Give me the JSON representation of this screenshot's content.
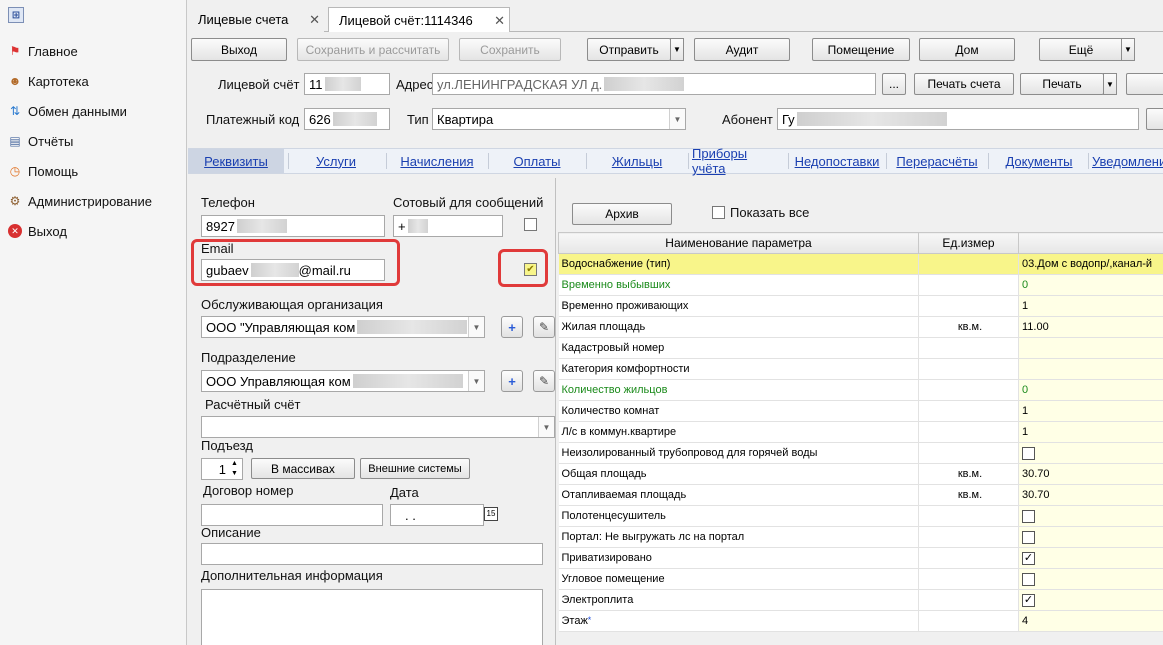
{
  "sidebar": {
    "items": [
      {
        "label": "Главное",
        "icon": "flag-icon"
      },
      {
        "label": "Картотека",
        "icon": "people-icon"
      },
      {
        "label": "Обмен данными",
        "icon": "exchange-icon"
      },
      {
        "label": "Отчёты",
        "icon": "reports-icon"
      },
      {
        "label": "Помощь",
        "icon": "help-icon"
      },
      {
        "label": "Администрирование",
        "icon": "admin-icon"
      },
      {
        "label": "Выход",
        "icon": "exit-icon"
      }
    ]
  },
  "tabs": [
    {
      "label": "Лицевые счета"
    },
    {
      "label": "Лицевой счёт:1114346"
    }
  ],
  "toolbar": {
    "exit": "Выход",
    "save_calc": "Сохранить и рассчитать",
    "save": "Сохранить",
    "send": "Отправить",
    "audit": "Аудит",
    "premises": "Помещение",
    "house": "Дом",
    "more": "Ещё"
  },
  "header": {
    "account_label": "Лицевой счёт",
    "account_value": "11",
    "address_label": "Адрес",
    "address_value": "ул.ЛЕНИНГРАДСКАЯ УЛ д.",
    "ellipsis": "...",
    "print_account": "Печать счета",
    "print": "Печать",
    "payment_code_label": "Платежный код",
    "payment_code_value": "626",
    "type_label": "Тип",
    "type_value": "Квартира",
    "subscriber_label": "Абонент",
    "subscriber_value": "Гу"
  },
  "subtabs": [
    "Реквизиты",
    "Услуги",
    "Начисления",
    "Оплаты",
    "Жильцы",
    "Приборы учёта",
    "Недопоставки",
    "Перерасчёты",
    "Документы",
    "Уведомлени"
  ],
  "form": {
    "phone_label": "Телефон",
    "phone_value": "8927",
    "mobile_label": "Сотовый для сообщений",
    "mobile_value": "+",
    "email_label": "Email",
    "email_value_start": "gubaev",
    "email_value_end": "@mail.ru",
    "org_label": "Обслуживающая организация",
    "org_value": "ООО \"Управляющая ком",
    "division_label": "Подразделение",
    "division_value": "ООО Управляющая ком",
    "account_label": "Расчётный счёт",
    "entrance_label": "Подъезд",
    "entrance_value": "1",
    "mass_btn": "В массивах",
    "ext_btn": "Внешние системы",
    "contract_label": "Договор номер",
    "date_label": "Дата",
    "date_value": ". .",
    "description_label": "Описание",
    "extra_label": "Дополнительная информация"
  },
  "params": {
    "archive_btn": "Архив",
    "show_all": "Показать все",
    "col_name": "Наименование параметра",
    "col_unit": "Ед.измер",
    "rows": [
      {
        "name": "Водоснабжение (тип)",
        "unit": "",
        "value": "03.Дом с водопр/,канал-й",
        "type": "text",
        "hl": true
      },
      {
        "name": "Временно выбывших",
        "unit": "",
        "value": "0",
        "type": "text",
        "green": true
      },
      {
        "name": "Временно проживающих",
        "unit": "",
        "value": "1",
        "type": "text"
      },
      {
        "name": "Жилая площадь",
        "unit": "кв.м.",
        "value": "11.00",
        "type": "text"
      },
      {
        "name": "Кадастровый номер",
        "unit": "",
        "value": "",
        "type": "text"
      },
      {
        "name": "Категория комфортности",
        "unit": "",
        "value": "",
        "type": "text"
      },
      {
        "name": "Количество жильцов",
        "unit": "",
        "value": "0",
        "type": "text",
        "green": true
      },
      {
        "name": "Количество комнат",
        "unit": "",
        "value": "1",
        "type": "text"
      },
      {
        "name": "Л/с в коммун.квартире",
        "unit": "",
        "value": "1",
        "type": "text"
      },
      {
        "name": "Неизолированный трубопровод для горячей воды",
        "unit": "",
        "value": "",
        "type": "check",
        "checked": false
      },
      {
        "name": "Общая площадь",
        "unit": "кв.м.",
        "value": "30.70",
        "type": "text"
      },
      {
        "name": "Отапливаемая площадь",
        "unit": "кв.м.",
        "value": "30.70",
        "type": "text"
      },
      {
        "name": "Полотенцесушитель",
        "unit": "",
        "value": "",
        "type": "check",
        "checked": false
      },
      {
        "name": "Портал: Не выгружать лс на портал",
        "unit": "",
        "value": "",
        "type": "check",
        "checked": false
      },
      {
        "name": "Приватизировано",
        "unit": "",
        "value": "",
        "type": "check",
        "checked": true
      },
      {
        "name": "Угловое помещение",
        "unit": "",
        "value": "",
        "type": "check",
        "checked": false
      },
      {
        "name": "Электроплита",
        "unit": "",
        "value": "",
        "type": "check",
        "checked": true
      },
      {
        "name": "Этаж",
        "unit": "",
        "value": "4",
        "type": "text",
        "required": true
      }
    ]
  },
  "colors": {
    "highlight": "#f8f58a",
    "link": "#1a3fb0",
    "annotation": "#e03a3a",
    "green": "#1a8a1a"
  }
}
